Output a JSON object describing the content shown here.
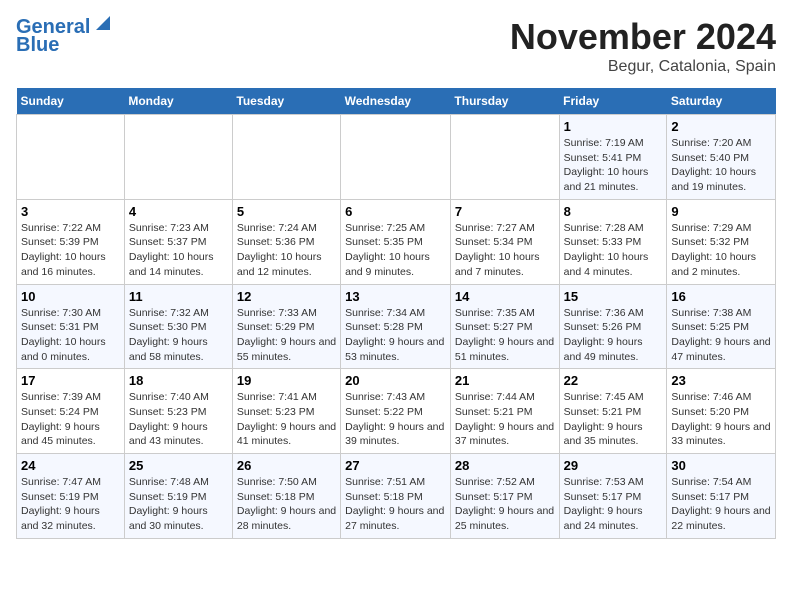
{
  "header": {
    "logo_line1": "General",
    "logo_line2": "Blue",
    "title": "November 2024",
    "subtitle": "Begur, Catalonia, Spain"
  },
  "days_of_week": [
    "Sunday",
    "Monday",
    "Tuesday",
    "Wednesday",
    "Thursday",
    "Friday",
    "Saturday"
  ],
  "weeks": [
    [
      {
        "day": "",
        "info": ""
      },
      {
        "day": "",
        "info": ""
      },
      {
        "day": "",
        "info": ""
      },
      {
        "day": "",
        "info": ""
      },
      {
        "day": "",
        "info": ""
      },
      {
        "day": "1",
        "info": "Sunrise: 7:19 AM\nSunset: 5:41 PM\nDaylight: 10 hours and 21 minutes."
      },
      {
        "day": "2",
        "info": "Sunrise: 7:20 AM\nSunset: 5:40 PM\nDaylight: 10 hours and 19 minutes."
      }
    ],
    [
      {
        "day": "3",
        "info": "Sunrise: 7:22 AM\nSunset: 5:39 PM\nDaylight: 10 hours and 16 minutes."
      },
      {
        "day": "4",
        "info": "Sunrise: 7:23 AM\nSunset: 5:37 PM\nDaylight: 10 hours and 14 minutes."
      },
      {
        "day": "5",
        "info": "Sunrise: 7:24 AM\nSunset: 5:36 PM\nDaylight: 10 hours and 12 minutes."
      },
      {
        "day": "6",
        "info": "Sunrise: 7:25 AM\nSunset: 5:35 PM\nDaylight: 10 hours and 9 minutes."
      },
      {
        "day": "7",
        "info": "Sunrise: 7:27 AM\nSunset: 5:34 PM\nDaylight: 10 hours and 7 minutes."
      },
      {
        "day": "8",
        "info": "Sunrise: 7:28 AM\nSunset: 5:33 PM\nDaylight: 10 hours and 4 minutes."
      },
      {
        "day": "9",
        "info": "Sunrise: 7:29 AM\nSunset: 5:32 PM\nDaylight: 10 hours and 2 minutes."
      }
    ],
    [
      {
        "day": "10",
        "info": "Sunrise: 7:30 AM\nSunset: 5:31 PM\nDaylight: 10 hours and 0 minutes."
      },
      {
        "day": "11",
        "info": "Sunrise: 7:32 AM\nSunset: 5:30 PM\nDaylight: 9 hours and 58 minutes."
      },
      {
        "day": "12",
        "info": "Sunrise: 7:33 AM\nSunset: 5:29 PM\nDaylight: 9 hours and 55 minutes."
      },
      {
        "day": "13",
        "info": "Sunrise: 7:34 AM\nSunset: 5:28 PM\nDaylight: 9 hours and 53 minutes."
      },
      {
        "day": "14",
        "info": "Sunrise: 7:35 AM\nSunset: 5:27 PM\nDaylight: 9 hours and 51 minutes."
      },
      {
        "day": "15",
        "info": "Sunrise: 7:36 AM\nSunset: 5:26 PM\nDaylight: 9 hours and 49 minutes."
      },
      {
        "day": "16",
        "info": "Sunrise: 7:38 AM\nSunset: 5:25 PM\nDaylight: 9 hours and 47 minutes."
      }
    ],
    [
      {
        "day": "17",
        "info": "Sunrise: 7:39 AM\nSunset: 5:24 PM\nDaylight: 9 hours and 45 minutes."
      },
      {
        "day": "18",
        "info": "Sunrise: 7:40 AM\nSunset: 5:23 PM\nDaylight: 9 hours and 43 minutes."
      },
      {
        "day": "19",
        "info": "Sunrise: 7:41 AM\nSunset: 5:23 PM\nDaylight: 9 hours and 41 minutes."
      },
      {
        "day": "20",
        "info": "Sunrise: 7:43 AM\nSunset: 5:22 PM\nDaylight: 9 hours and 39 minutes."
      },
      {
        "day": "21",
        "info": "Sunrise: 7:44 AM\nSunset: 5:21 PM\nDaylight: 9 hours and 37 minutes."
      },
      {
        "day": "22",
        "info": "Sunrise: 7:45 AM\nSunset: 5:21 PM\nDaylight: 9 hours and 35 minutes."
      },
      {
        "day": "23",
        "info": "Sunrise: 7:46 AM\nSunset: 5:20 PM\nDaylight: 9 hours and 33 minutes."
      }
    ],
    [
      {
        "day": "24",
        "info": "Sunrise: 7:47 AM\nSunset: 5:19 PM\nDaylight: 9 hours and 32 minutes."
      },
      {
        "day": "25",
        "info": "Sunrise: 7:48 AM\nSunset: 5:19 PM\nDaylight: 9 hours and 30 minutes."
      },
      {
        "day": "26",
        "info": "Sunrise: 7:50 AM\nSunset: 5:18 PM\nDaylight: 9 hours and 28 minutes."
      },
      {
        "day": "27",
        "info": "Sunrise: 7:51 AM\nSunset: 5:18 PM\nDaylight: 9 hours and 27 minutes."
      },
      {
        "day": "28",
        "info": "Sunrise: 7:52 AM\nSunset: 5:17 PM\nDaylight: 9 hours and 25 minutes."
      },
      {
        "day": "29",
        "info": "Sunrise: 7:53 AM\nSunset: 5:17 PM\nDaylight: 9 hours and 24 minutes."
      },
      {
        "day": "30",
        "info": "Sunrise: 7:54 AM\nSunset: 5:17 PM\nDaylight: 9 hours and 22 minutes."
      }
    ]
  ]
}
